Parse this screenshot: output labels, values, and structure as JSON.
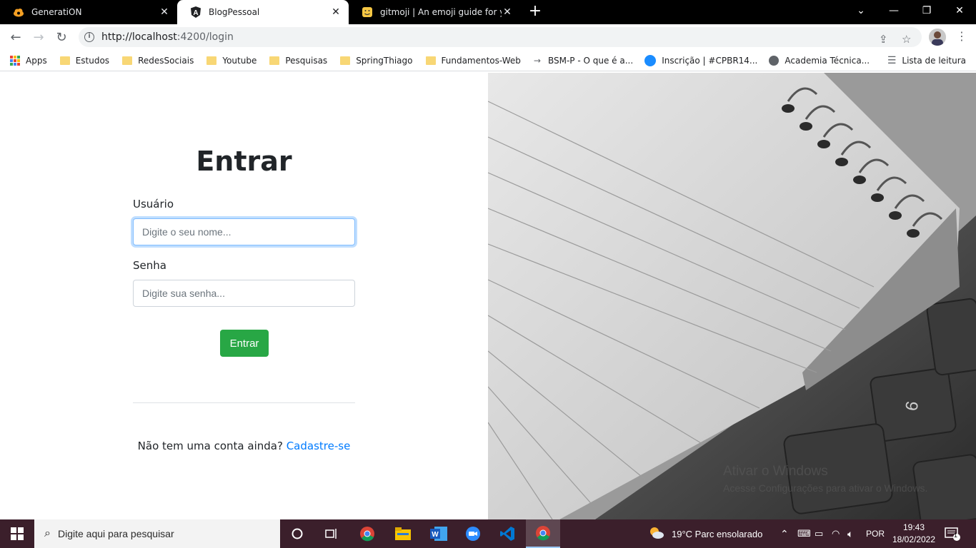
{
  "browser": {
    "tabs": [
      {
        "title": "GeneratiON",
        "active": false
      },
      {
        "title": "BlogPessoal",
        "active": true
      },
      {
        "title": "gitmoji | An emoji guide for your",
        "active": false
      }
    ],
    "url_host": "http://localhost",
    "url_path": ":4200/login",
    "bookmarks": [
      {
        "label": "Apps",
        "icon": "apps-grid-icon"
      },
      {
        "label": "Estudos",
        "icon": "folder-icon"
      },
      {
        "label": "RedesSociais",
        "icon": "folder-icon"
      },
      {
        "label": "Youtube",
        "icon": "folder-icon"
      },
      {
        "label": "Pesquisas",
        "icon": "folder-icon"
      },
      {
        "label": "SpringThiago",
        "icon": "folder-icon"
      },
      {
        "label": "Fundamentos-Web",
        "icon": "folder-icon"
      },
      {
        "label": "BSM-P - O que é a...",
        "icon": "arrow-icon"
      },
      {
        "label": "Inscrição | #CPBR14...",
        "icon": "blue-circle-icon"
      },
      {
        "label": "Academia Técnica...",
        "icon": "globe-icon"
      }
    ],
    "reading_list": "Lista de leitura"
  },
  "login": {
    "heading": "Entrar",
    "user_label": "Usuário",
    "user_placeholder": "Digite o seu nome...",
    "password_label": "Senha",
    "password_placeholder": "Digite sua senha...",
    "submit_label": "Entrar",
    "signup_prompt": "Não tem uma conta ainda?",
    "signup_link": "Cadastre-se"
  },
  "watermark": {
    "line1": "Ativar o Windows",
    "line2": "Acesse Configurações para ativar o Windows."
  },
  "taskbar": {
    "search_placeholder": "Digite aqui para pesquisar",
    "weather": "19°C  Parc ensolarado",
    "language": "POR",
    "time": "19:43",
    "date": "18/02/2022",
    "notification_count": "1"
  },
  "colors": {
    "accent_green": "#28a745",
    "link_blue": "#007bff",
    "taskbar": "#3b1f2b"
  }
}
